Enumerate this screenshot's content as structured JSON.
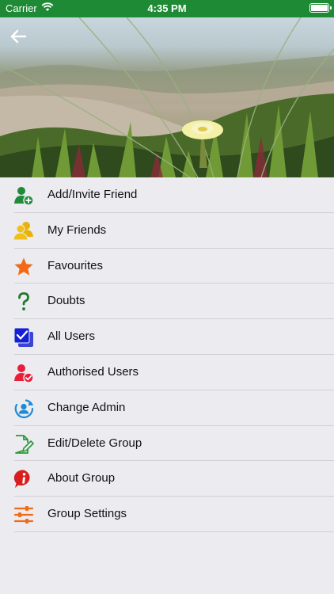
{
  "status_bar": {
    "carrier": "Carrier",
    "time": "4:35 PM",
    "icons": [
      "wifi-icon",
      "battery-icon"
    ]
  },
  "header": {
    "back_icon": "back-arrow-icon"
  },
  "menu": {
    "items": [
      {
        "label": "Add/Invite Friend",
        "icon": "add-user-icon",
        "color": "#1e8a3a"
      },
      {
        "label": "My Friends",
        "icon": "friends-icon",
        "color": "#e8b20a"
      },
      {
        "label": "Favourites",
        "icon": "star-icon",
        "color": "#f26a16"
      },
      {
        "label": "Doubts",
        "icon": "question-icon",
        "color": "#1e7a2a"
      },
      {
        "label": "All Users",
        "icon": "checkbox-stack-icon",
        "color": "#1420d6"
      },
      {
        "label": "Authorised Users",
        "icon": "verified-user-icon",
        "color": "#e81e3a"
      },
      {
        "label": "Change Admin",
        "icon": "admin-switch-icon",
        "color": "#1e8ad6"
      },
      {
        "label": "Edit/Delete Group",
        "icon": "edit-document-icon",
        "color": "#2a9a3a"
      },
      {
        "label": "About Group",
        "icon": "info-icon",
        "color": "#d81e1e"
      },
      {
        "label": "Group Settings",
        "icon": "sliders-icon",
        "color": "#f26a16"
      }
    ]
  }
}
